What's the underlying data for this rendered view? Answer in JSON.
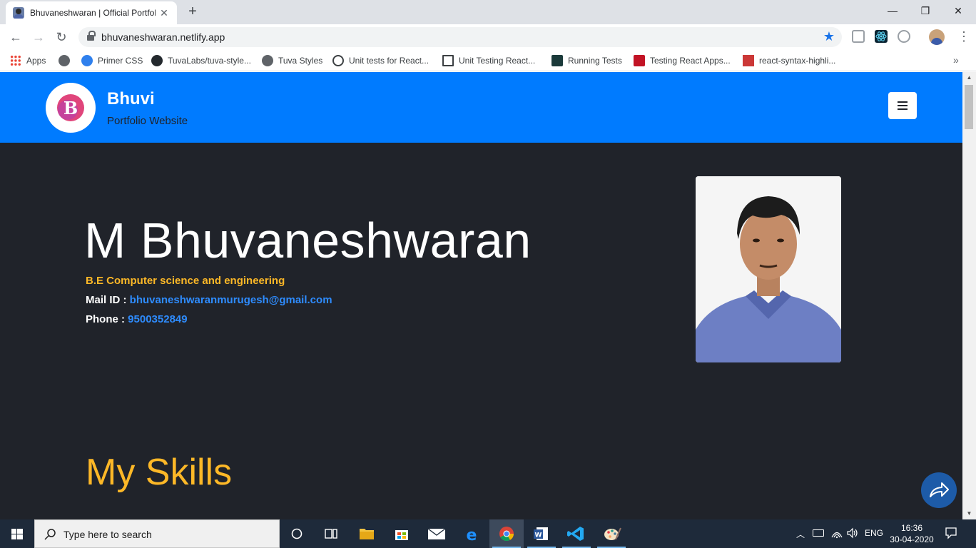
{
  "browser": {
    "tab_title": "Bhuvaneshwaran | Official Portfolio",
    "url": "bhuvaneshwaran.netlify.app",
    "bookmarks": [
      {
        "label": "Apps",
        "icon": "apps-grid-icon"
      },
      {
        "label": "",
        "icon": "globe-icon"
      },
      {
        "label": "Primer CSS",
        "icon": "primer-icon"
      },
      {
        "label": "TuvaLabs/tuva-style...",
        "icon": "github-icon"
      },
      {
        "label": "Tuva Styles",
        "icon": "globe-icon"
      },
      {
        "label": "Unit tests for React...",
        "icon": "web-icon"
      },
      {
        "label": "Unit Testing React...",
        "icon": "page-icon"
      },
      {
        "label": "Running Tests",
        "icon": "react-icon"
      },
      {
        "label": "Testing React Apps...",
        "icon": "jest-icon"
      },
      {
        "label": "react-syntax-highli...",
        "icon": "npm-icon"
      }
    ]
  },
  "site": {
    "brand_title": "Bhuvi",
    "brand_subtitle": "Portfolio Website",
    "name": "M Bhuvaneshwaran",
    "degree": "B.E Computer science and engineering",
    "mail_label": "Mail ID : ",
    "mail_value": "bhuvaneshwaranmurugesh@gmail.com",
    "phone_label": "Phone : ",
    "phone_value": "9500352849",
    "skills_title": "My Skills"
  },
  "taskbar": {
    "search_placeholder": "Type here to search",
    "language": "ENG",
    "time": "16:36",
    "date": "30-04-2020"
  },
  "colors": {
    "navbar": "#007bff",
    "page_bg": "#20232a",
    "accent": "#fdb827",
    "link": "#2e8cff"
  }
}
